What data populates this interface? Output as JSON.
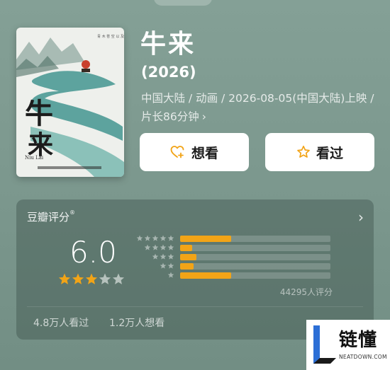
{
  "movie": {
    "title": "牛来",
    "year": "(2026)",
    "meta": "中国大陆 / 动画 / 2026-08-05(中国大陆)上映 / 片长86分钟",
    "meta_chevron": "›"
  },
  "poster": {
    "title_glyphs": [
      "牛",
      "来"
    ],
    "small_title": "Niu Lai"
  },
  "actions": {
    "want_label": "想看",
    "seen_label": "看过"
  },
  "rating": {
    "source_label": "豆瓣评分",
    "source_mark": "®",
    "score": "6.0",
    "score_stars": 3,
    "count_label": "44295人评分",
    "distribution": [
      {
        "stars": 5,
        "fraction": 0.34
      },
      {
        "stars": 4,
        "fraction": 0.08
      },
      {
        "stars": 3,
        "fraction": 0.11
      },
      {
        "stars": 2,
        "fraction": 0.09
      },
      {
        "stars": 1,
        "fraction": 0.34
      }
    ],
    "seen_label": "4.8万人看过",
    "want_label": "1.2万人想看",
    "chevron": "›"
  },
  "watermark": {
    "text": "链懂",
    "sub": "NEATDOWN.COM"
  },
  "colors": {
    "accent": "#f2a417",
    "background": "#7f9b91",
    "star_empty": "#b6c2bd",
    "watermark_blue": "#2c6fd6"
  }
}
